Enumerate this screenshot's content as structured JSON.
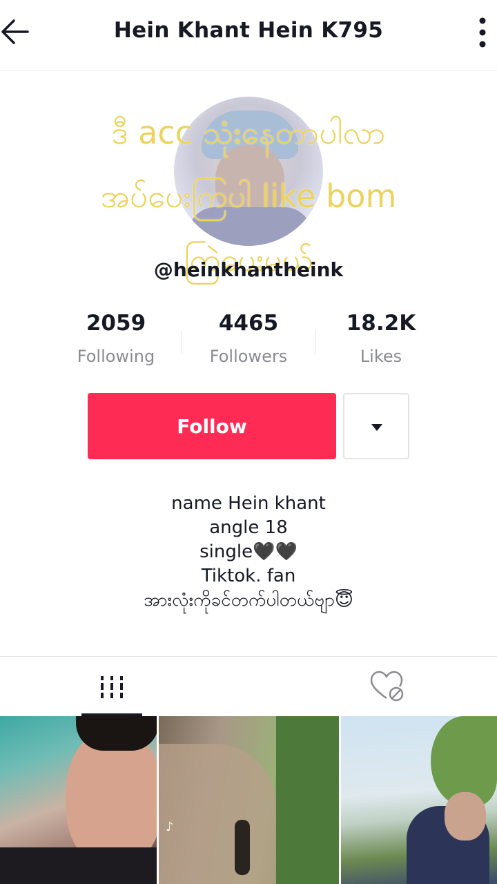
{
  "header": {
    "title": "Hein Khant Hein K795",
    "back_icon": "arrow-left-icon",
    "more_icon": "more-vertical-icon"
  },
  "overlay": {
    "lines": [
      "ဒီ acc သုံးနေတာပါလာ",
      "အပ်ပေးကြပါ like bom",
      "ကြဲပေးမယ်"
    ]
  },
  "profile": {
    "username": "@heinkhantheink"
  },
  "stats": [
    {
      "value": "2059",
      "label": "Following"
    },
    {
      "value": "4465",
      "label": "Followers"
    },
    {
      "value": "18.2K",
      "label": "Likes"
    }
  ],
  "actions": {
    "follow_label": "Follow",
    "dropdown_icon": "caret-down-icon",
    "follow_color": "#fe2c55"
  },
  "bio": {
    "lines": [
      "name Hein khant",
      "angle 18",
      "single🖤🖤",
      "Tiktok. fan",
      "အားလုံးကိုခင်တက်ပါတယ်ဗျာ😇"
    ]
  },
  "tabs": [
    {
      "icon": "grid-icon",
      "active": true
    },
    {
      "icon": "liked-hidden-icon",
      "active": false
    }
  ],
  "videos": [
    {
      "thumb": "selfie"
    },
    {
      "thumb": "rock-climb"
    },
    {
      "thumb": "outdoor-portrait"
    }
  ]
}
